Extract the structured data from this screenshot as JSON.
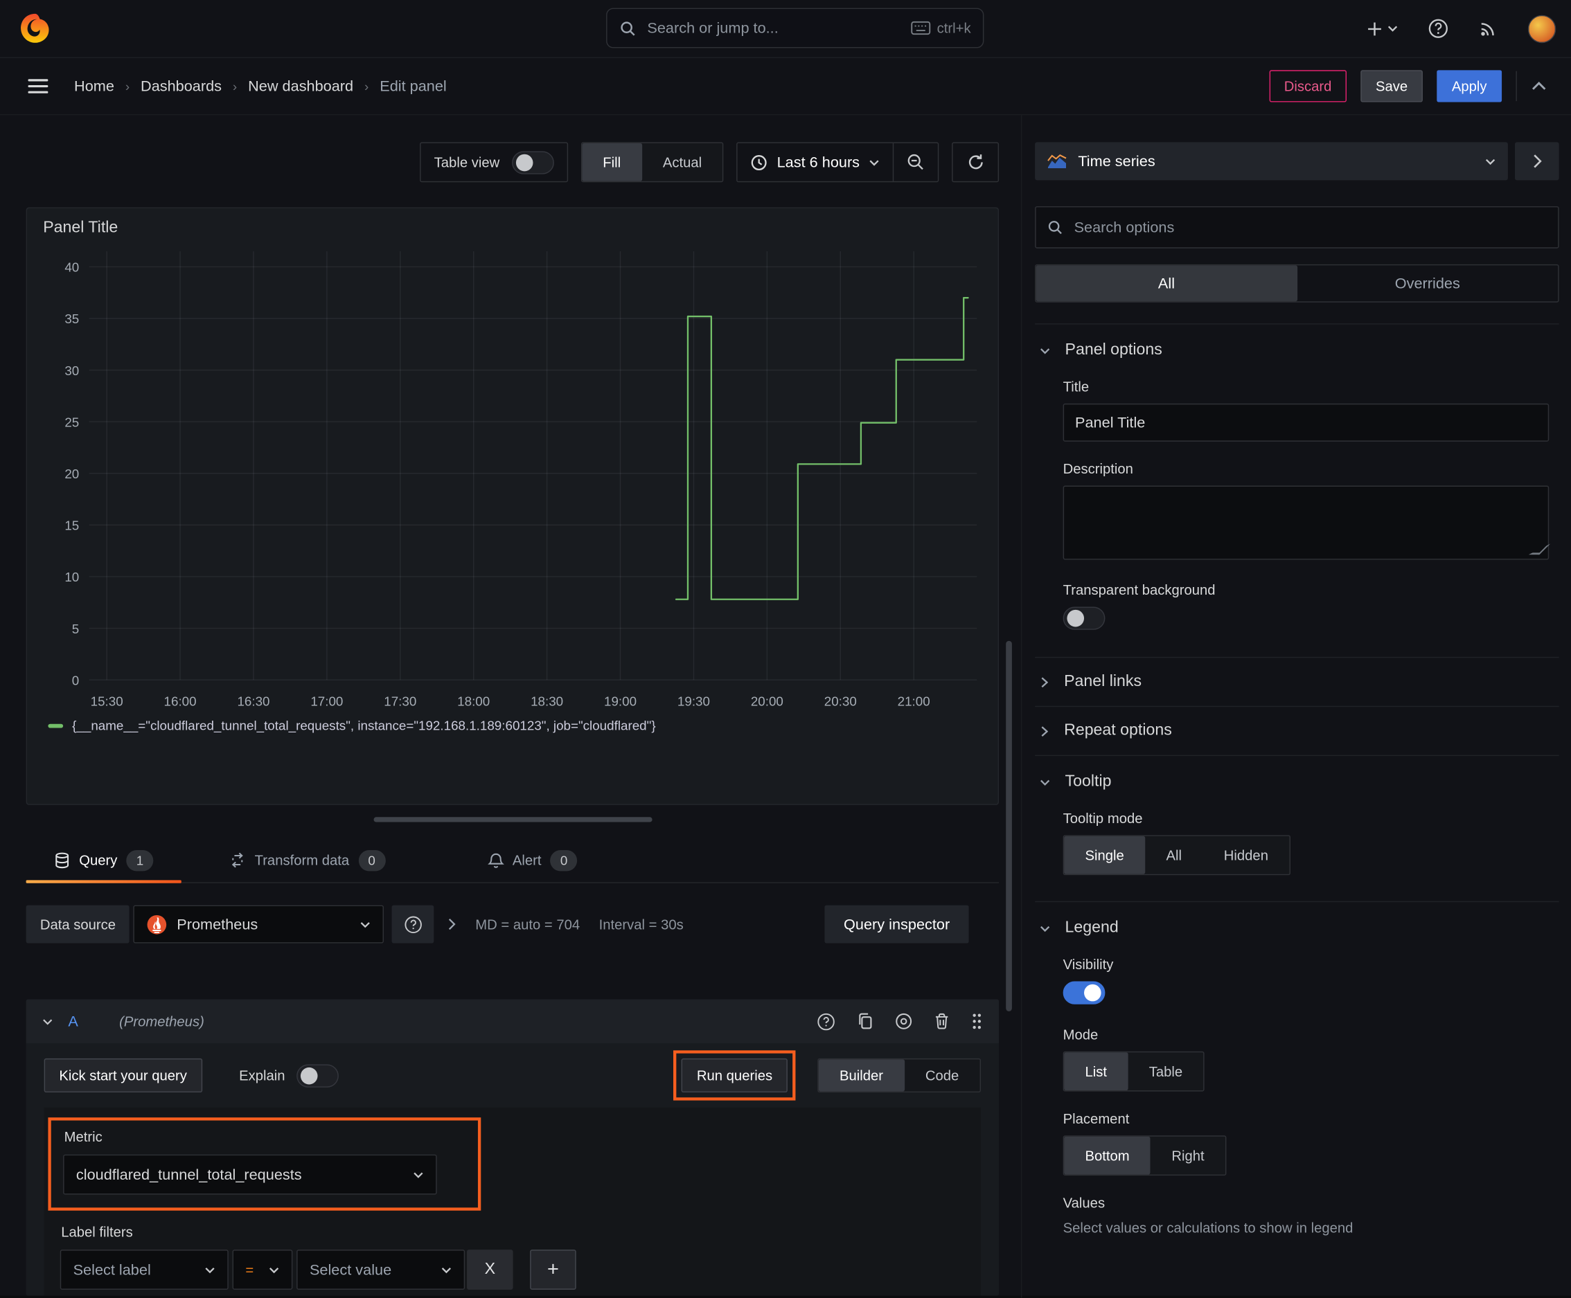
{
  "colors": {
    "accent_orange": "#F55E1F",
    "tab_underline": "#F2541B",
    "series_green": "#73BF69",
    "apply_blue": "#3D71D9",
    "discard_pink": "#E0226E",
    "refid_blue": "#5794F2"
  },
  "icons": {
    "grafana-logo": "orange flame swirl",
    "search-icon": "magnifier",
    "keyboard-icon": "keyboard",
    "add-icon": "plus with caret",
    "help-icon": "question circle",
    "rss-icon": "broadcast arcs",
    "hamburger-icon": "three bars",
    "clock-icon": "clock",
    "zoom-out-icon": "magnifier minus",
    "refresh-icon": "circular arrow",
    "database-icon": "db cylinder",
    "transform-icon": "looping arrows",
    "bell-icon": "bell",
    "copy-icon": "two documents",
    "eye-icon": "circle dot",
    "trash-icon": "bin",
    "drag-handle-icon": "six dots",
    "resize-icon": "diagonal grip"
  },
  "topbar": {
    "search_placeholder": "Search or jump to...",
    "shortcut": "ctrl+k"
  },
  "breadcrumb": {
    "items": [
      "Home",
      "Dashboards",
      "New dashboard",
      "Edit panel"
    ]
  },
  "actions": {
    "discard": "Discard",
    "save": "Save",
    "apply": "Apply"
  },
  "toolbar": {
    "table_view": "Table view",
    "fill": "Fill",
    "actual": "Actual",
    "time_range": "Last 6 hours"
  },
  "panel": {
    "title": "Panel Title"
  },
  "chart_data": {
    "type": "line",
    "title": "Panel Title",
    "x_ticks": [
      "15:30",
      "16:00",
      "16:30",
      "17:00",
      "17:30",
      "18:00",
      "18:30",
      "19:00",
      "19:30",
      "20:00",
      "20:30",
      "21:00"
    ],
    "x_tick_hours": [
      15.5,
      16,
      16.5,
      17,
      17.5,
      18,
      18.5,
      19,
      19.5,
      20,
      20.5,
      21
    ],
    "x_range_hours": [
      15.38,
      21.43
    ],
    "y_ticks": [
      0,
      5,
      10,
      15,
      20,
      25,
      30,
      35,
      40
    ],
    "y_range": [
      0,
      41.5
    ],
    "grid": true,
    "legend_position": "bottom",
    "series": [
      {
        "name": "{__name__=\"cloudflared_tunnel_total_requests\", instance=\"192.168.1.189:60123\", job=\"cloudflared\"}",
        "color": "#73BF69",
        "step_points": [
          [
            19.38,
            7.8
          ],
          [
            19.46,
            35.2
          ],
          [
            19.62,
            7.8
          ],
          [
            20.21,
            20.9
          ],
          [
            20.64,
            24.9
          ],
          [
            20.88,
            31.0
          ],
          [
            21.34,
            37.0
          ]
        ],
        "end_hour": 21.37
      }
    ]
  },
  "tabs": {
    "query": {
      "label": "Query",
      "count": "1"
    },
    "transform": {
      "label": "Transform data",
      "count": "0"
    },
    "alert": {
      "label": "Alert",
      "count": "0"
    }
  },
  "datasource": {
    "label": "Data source",
    "name": "Prometheus",
    "stats_md": "MD = auto = 704",
    "stats_interval": "Interval = 30s",
    "inspector": "Query inspector"
  },
  "query": {
    "ref_id": "A",
    "ds_hint": "(Prometheus)",
    "kickstart": "Kick start your query",
    "explain": "Explain",
    "run": "Run queries",
    "builder": "Builder",
    "code": "Code",
    "metric_label": "Metric",
    "metric_value": "cloudflared_tunnel_total_requests",
    "label_filters_label": "Label filters",
    "select_label": "Select label",
    "operator": "=",
    "select_value": "Select value",
    "remove": "X",
    "add": "+"
  },
  "options": {
    "viz": "Time series",
    "search_placeholder": "Search options",
    "tab_all": "All",
    "tab_overrides": "Overrides",
    "panel_options": {
      "title": "Panel options",
      "title_label": "Title",
      "title_value": "Panel Title",
      "description_label": "Description",
      "transparent": "Transparent background"
    },
    "links": "Panel links",
    "repeat": "Repeat options",
    "tooltip": {
      "title": "Tooltip",
      "mode_label": "Tooltip mode",
      "modes": [
        "Single",
        "All",
        "Hidden"
      ]
    },
    "legend": {
      "title": "Legend",
      "visibility": "Visibility",
      "mode_label": "Mode",
      "modes": [
        "List",
        "Table"
      ],
      "placement_label": "Placement",
      "placements": [
        "Bottom",
        "Right"
      ],
      "values_label": "Values",
      "values_desc": "Select values or calculations to show in legend"
    }
  }
}
